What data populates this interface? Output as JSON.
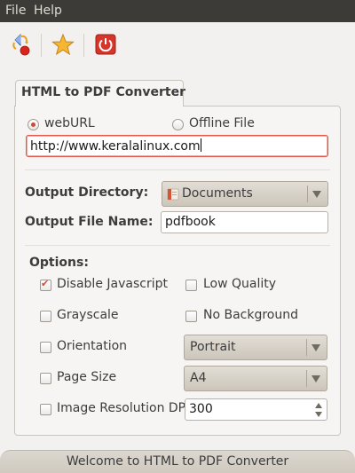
{
  "menubar": {
    "items": [
      "File",
      "Help"
    ]
  },
  "toolbar": {
    "buttons": [
      {
        "icon": "convert-icon",
        "label": "Convert"
      },
      {
        "icon": "star-icon",
        "label": "Favorite"
      },
      {
        "icon": "power-icon",
        "label": "Quit"
      }
    ]
  },
  "tab": {
    "title": "HTML to PDF Converter"
  },
  "source": {
    "web_url_label": "webURL",
    "offline_file_label": "Offline File",
    "selected": "webURL",
    "url_value": "http://www.keralalinux.com"
  },
  "output": {
    "directory_label": "Output Directory:",
    "directory_value": "Documents",
    "filename_label": "Output File Name:",
    "filename_value": "pdfbook"
  },
  "options": {
    "title": "Options:",
    "disable_javascript": {
      "label": "Disable Javascript",
      "checked": true
    },
    "low_quality": {
      "label": "Low Quality",
      "checked": false
    },
    "grayscale": {
      "label": "Grayscale",
      "checked": false
    },
    "no_background": {
      "label": "No Background",
      "checked": false
    },
    "orientation": {
      "label": "Orientation",
      "checked": false,
      "value": "Portrait"
    },
    "page_size": {
      "label": "Page Size",
      "checked": false,
      "value": "A4"
    },
    "image_dpi": {
      "label": "Image Resolution DPI",
      "checked": false,
      "value": "300"
    }
  },
  "status": {
    "message": "Welcome to HTML to PDF Converter"
  },
  "colors": {
    "menubar_bg": "#3c3b37",
    "accent": "#e0594b",
    "window_bg": "#f2f1f0"
  }
}
